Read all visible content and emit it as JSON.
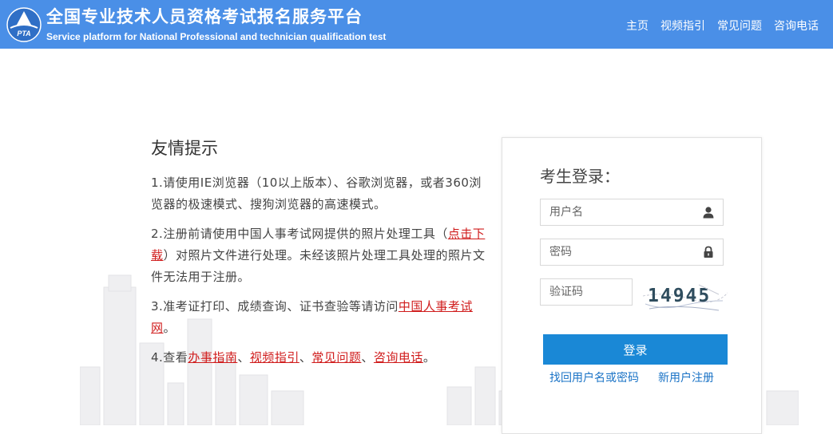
{
  "header": {
    "title_cn": "全国专业技术人员资格考试报名服务平台",
    "title_en": "Service platform for National Professional and technician qualification test",
    "logo_text": "PTA",
    "nav": [
      "主页",
      "视频指引",
      "常见问题",
      "咨询电话"
    ],
    "background": "#4a8fe7"
  },
  "tips": {
    "title": "友情提示",
    "item1": "1.请使用IE浏览器（10以上版本）、谷歌浏览器，或者360浏览器的极速模式、搜狗浏览器的高速模式。",
    "item2_before": "2.注册前请使用中国人事考试网提供的照片处理工具（",
    "item2_link": "点击下载",
    "item2_after": "）对照片文件进行处理。未经该照片处理工具处理的照片文件无法用于注册。",
    "item3_before": "3.准考证打印、成绩查询、证书查验等请访问",
    "item3_link": "中国人事考试网",
    "item3_after": "。",
    "item4_before": "4.查看",
    "item4_links": [
      "办事指南",
      "视频指引",
      "常见问题",
      "咨询电话"
    ],
    "separator": "、",
    "item4_after": "。",
    "link_color": "#d01c1c"
  },
  "login": {
    "title": "考生登录：",
    "username_placeholder": "用户名",
    "password_placeholder": "密码",
    "captcha_placeholder": "验证码",
    "captcha_text": "14945",
    "login_button": "登录",
    "forgot_link": "找回用户名或密码",
    "register_link": "新用户注册",
    "button_color": "#1a88d6",
    "link_color": "#1a73c6"
  }
}
